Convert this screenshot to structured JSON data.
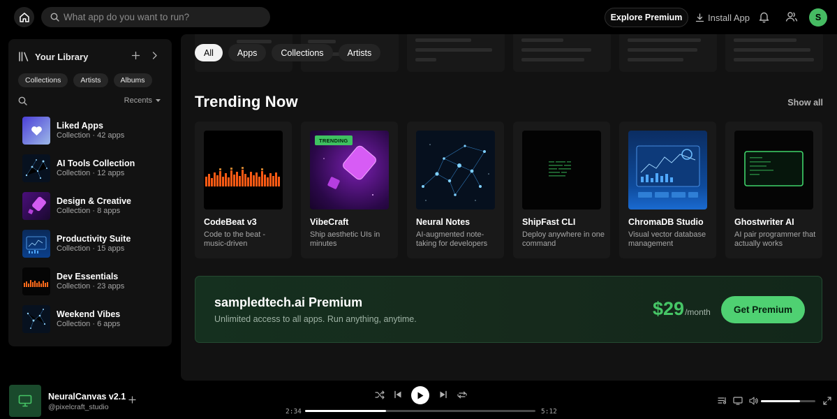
{
  "topbar": {
    "search_placeholder": "What app do you want to run?",
    "explore_label": "Explore Premium",
    "install_label": "Install App",
    "avatar_initial": "S"
  },
  "library": {
    "title": "Your Library",
    "chips": [
      "Collections",
      "Artists",
      "Albums"
    ],
    "sort_label": "Recents",
    "items": [
      {
        "name": "Liked Apps",
        "sub": "Collection · 42 apps"
      },
      {
        "name": "AI Tools Collection",
        "sub": "Collection · 12 apps"
      },
      {
        "name": "Design & Creative",
        "sub": "Collection · 8 apps"
      },
      {
        "name": "Productivity Suite",
        "sub": "Collection · 15 apps"
      },
      {
        "name": "Dev Essentials",
        "sub": "Collection · 23 apps"
      },
      {
        "name": "Weekend Vibes",
        "sub": "Collection · 6 apps"
      }
    ]
  },
  "main": {
    "filters": [
      "All",
      "Apps",
      "Collections",
      "Artists"
    ],
    "active_filter": "All",
    "section_title": "Trending Now",
    "show_all": "Show all",
    "cards": [
      {
        "title": "CodeBeat v3",
        "desc": "Code to the beat - music-driven"
      },
      {
        "title": "VibeCraft",
        "desc": "Ship aesthetic UIs in minutes",
        "badge": "TRENDING"
      },
      {
        "title": "Neural Notes",
        "desc": "AI-augmented note-taking for developers"
      },
      {
        "title": "ShipFast CLI",
        "desc": "Deploy anywhere in one command"
      },
      {
        "title": "ChromaDB Studio",
        "desc": "Visual vector database management"
      },
      {
        "title": "Ghostwriter AI",
        "desc": "AI pair programmer that actually works"
      }
    ],
    "premium": {
      "title": "sampledtech.ai Premium",
      "subtitle": "Unlimited access to all apps. Run anything, anytime.",
      "price": "$29",
      "period": "/month",
      "cta": "Get Premium"
    }
  },
  "player": {
    "title": "NeuralCanvas v2.1",
    "artist": "@pixelcraft_studio",
    "elapsed": "2:34",
    "total": "5:12",
    "progress": 0.35,
    "volume": 0.72
  },
  "colors": {
    "accent": "#46c566",
    "background": "#121212"
  }
}
